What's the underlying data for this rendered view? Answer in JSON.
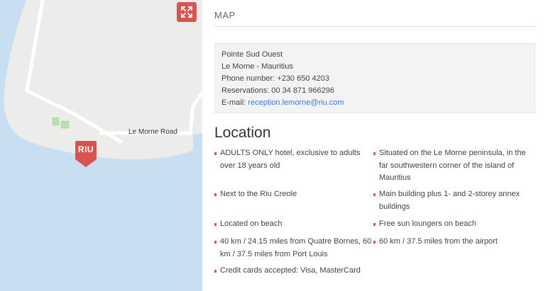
{
  "map": {
    "road_label": "Le Morne Road",
    "marker_label": "RIU",
    "fullscreen_icon": "expand-arrows-icon",
    "colors": {
      "water": "#c8dff2",
      "land": "#ececea",
      "road": "#ffffff",
      "marker": "#d9534f",
      "park": "#b7e0b0"
    }
  },
  "section_title": "MAP",
  "address": {
    "hotel": "Pointe Sud Ouest",
    "city": "Le Morne - Mauritius",
    "phone": "Phone number: +230 650 4203",
    "reservations": "Reservations: 00 34 871 966296",
    "email_label": "E-mail:",
    "email": "reception.lemorne@riu.com"
  },
  "location": {
    "heading": "Location",
    "features": [
      "ADULTS ONLY hotel, exclusive to adults over 18 years old",
      "Situated on the Le Morne peninsula, in the far southwestern corner of the island of Mauritius",
      "Next to the Riu Creole",
      "Main building plus 1- and 2-storey annex buildings",
      "Located on beach",
      "Free sun loungers on beach",
      "40 km / 24.15 miles from Quatre Bornes, 60 km / 37.5 miles from Port Louis",
      "60 km / 37.5 miles from the airport",
      "Credit cards accepted: Visa, MasterCard"
    ]
  },
  "accent_color": "#d9534f"
}
